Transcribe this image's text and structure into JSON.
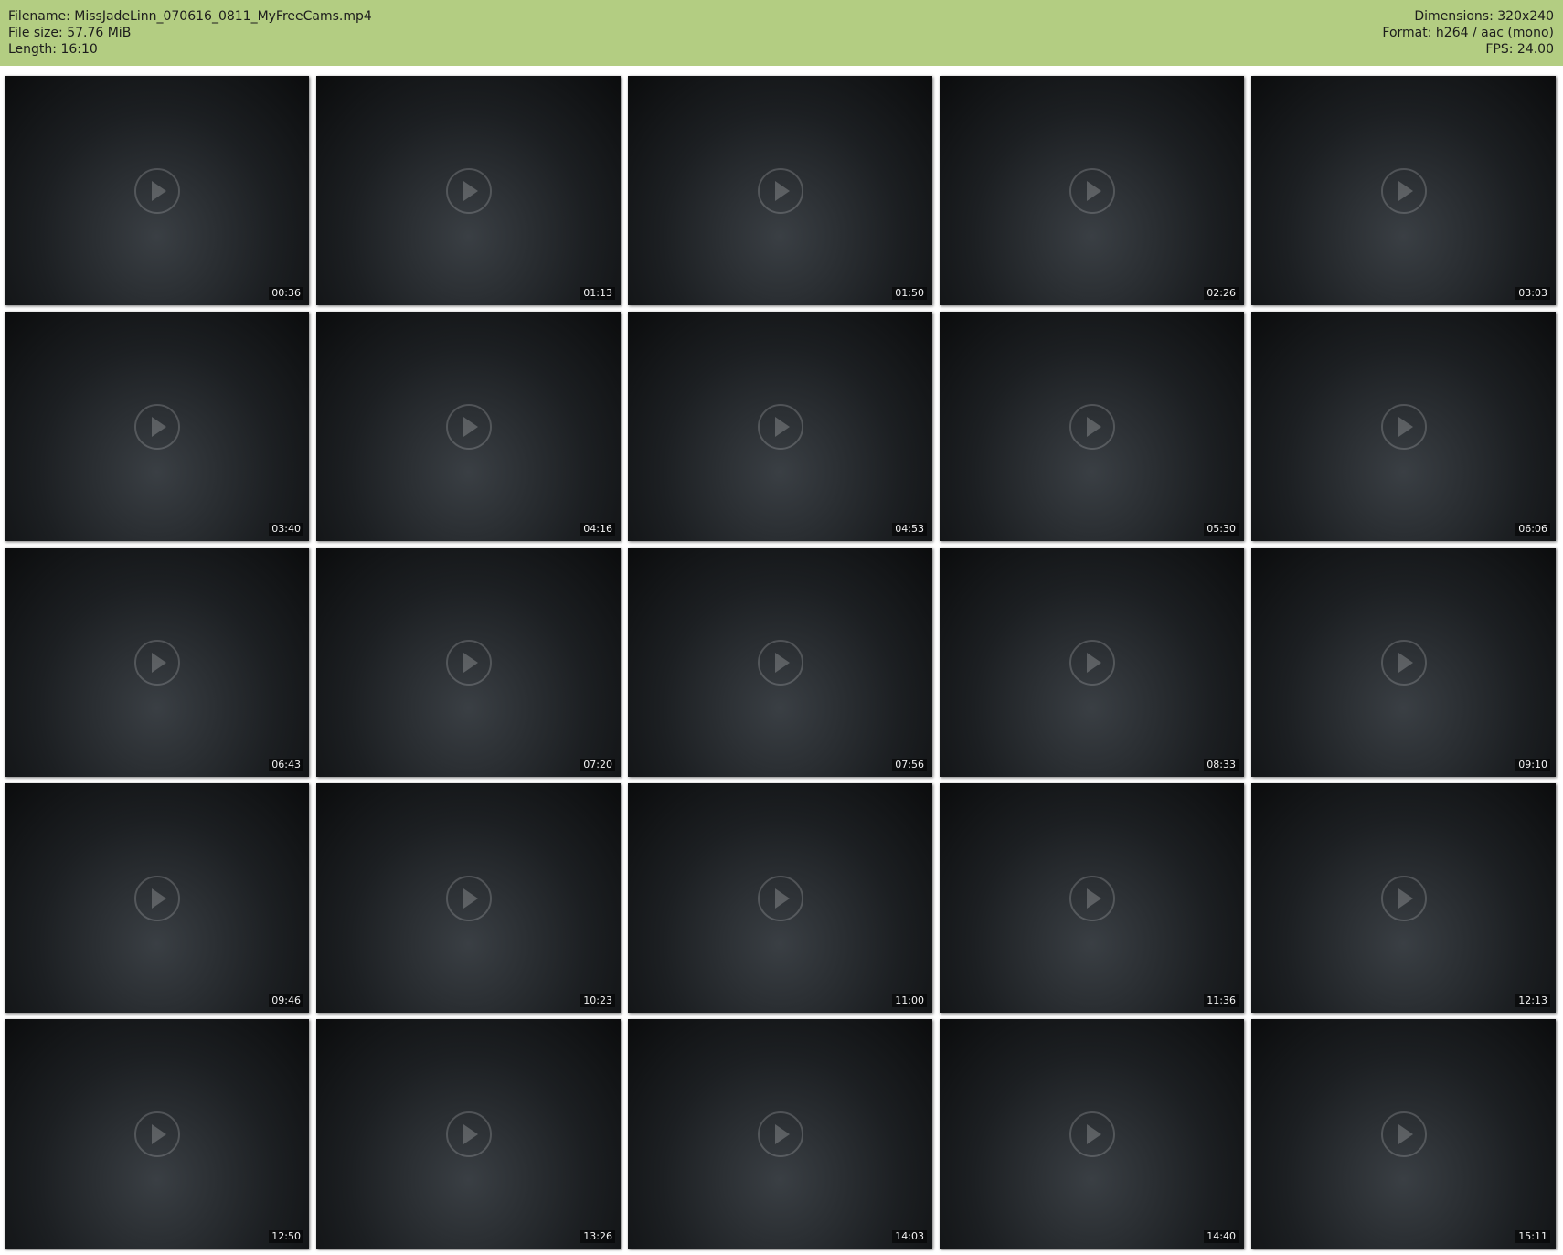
{
  "header": {
    "filename_line": "Filename: MissJadeLinn_070616_0811_MyFreeCams.mp4",
    "filesize_line": "File size: 57.76 MiB",
    "length_line": "Length: 16:10",
    "dimensions_line": "Dimensions: 320x240",
    "format_line": "Format: h264 / aac (mono)",
    "fps_line": "FPS: 24.00"
  },
  "thumbnails": [
    {
      "time": "00:36"
    },
    {
      "time": "01:13"
    },
    {
      "time": "01:50"
    },
    {
      "time": "02:26"
    },
    {
      "time": "03:03"
    },
    {
      "time": "03:40"
    },
    {
      "time": "04:16"
    },
    {
      "time": "04:53"
    },
    {
      "time": "05:30"
    },
    {
      "time": "06:06"
    },
    {
      "time": "06:43"
    },
    {
      "time": "07:20"
    },
    {
      "time": "07:56"
    },
    {
      "time": "08:33"
    },
    {
      "time": "09:10"
    },
    {
      "time": "09:46"
    },
    {
      "time": "10:23"
    },
    {
      "time": "11:00"
    },
    {
      "time": "11:36"
    },
    {
      "time": "12:13"
    },
    {
      "time": "12:50"
    },
    {
      "time": "13:26"
    },
    {
      "time": "14:03"
    },
    {
      "time": "14:40"
    },
    {
      "time": "15:11"
    }
  ],
  "colors": {
    "header_bg": "#b3cd82",
    "page_bg": "#ffffff"
  }
}
